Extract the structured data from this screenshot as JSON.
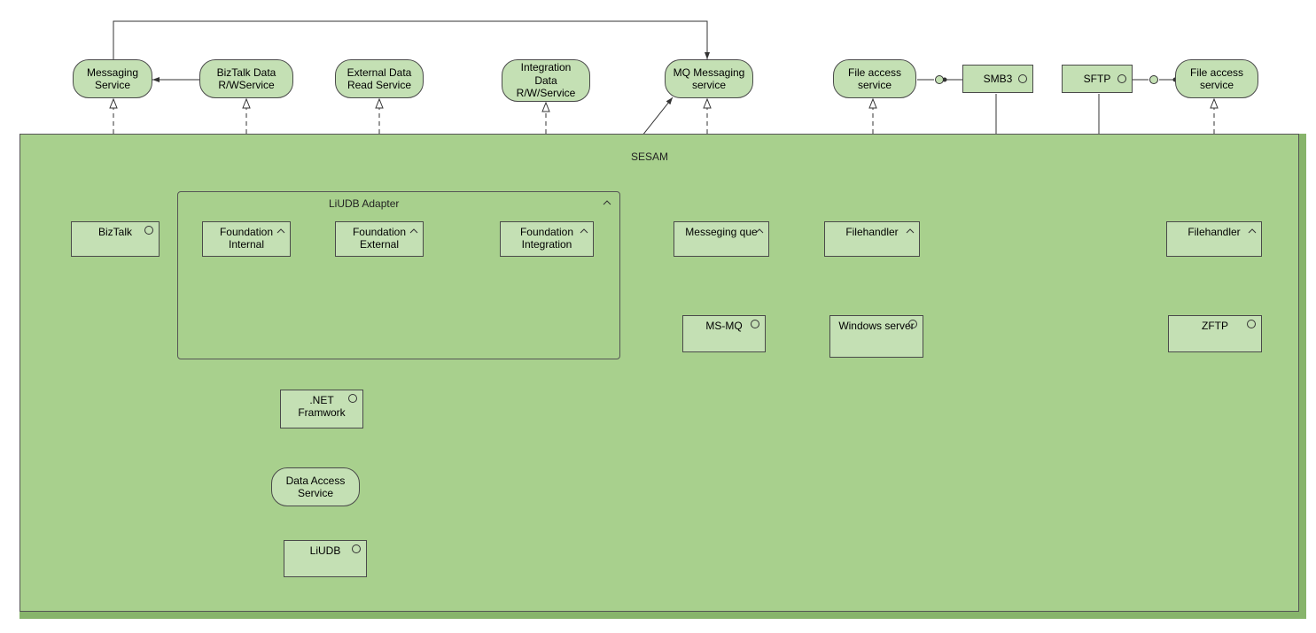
{
  "services": {
    "messaging": "Messaging Service",
    "biztalk_rw": "BizTalk Data R/WService",
    "external_read": "External Data Read Service",
    "integration_rw": "Integration Data R/W/Service",
    "mq_messaging": "MQ Messaging service",
    "file_access_left": "File access service",
    "file_access_right": "File access service",
    "data_access": "Data Access Service"
  },
  "interfaces": {
    "smb3": "SMB3",
    "sftp": "SFTP"
  },
  "groups": {
    "liudb_adapter": "LiUDB Adapter"
  },
  "labels": {
    "sesam": "SESAM"
  },
  "components": {
    "biztalk": "BizTalk",
    "foundation_internal": "Foundation Internal",
    "foundation_external": "Foundation External",
    "foundation_integration": "Foundation Integration",
    "messaging_queue": "Messeging que",
    "filehandler_left": "Filehandler",
    "filehandler_right": "Filehandler",
    "dotnet": ".NET Framwork",
    "msmq": "MS-MQ",
    "windows_server": "Windows server",
    "zftp": "ZFTP",
    "liudb": "LiUDB"
  },
  "colors": {
    "node_fill": "#c4e0b4",
    "slab_fill": "#a8d08d",
    "stroke": "#4a4a4a"
  }
}
